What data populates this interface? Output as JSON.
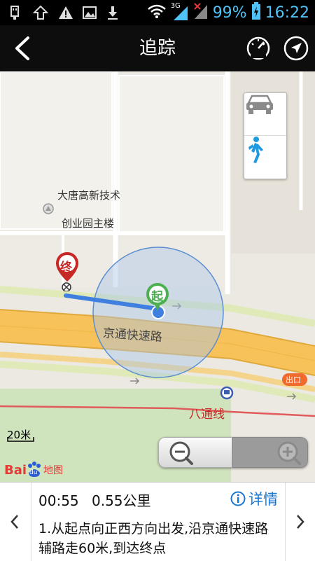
{
  "status_bar": {
    "icons": [
      "usb-icon",
      "upload-icon",
      "warning-icon",
      "image-icon",
      "download-icon",
      "wifi-icon",
      "signal-3g-icon",
      "signal-off-icon",
      "battery-charging-icon"
    ],
    "network_label": "3G",
    "battery_percent": "99%",
    "time": "16:22"
  },
  "header": {
    "title": "追踪",
    "left_icon": "back-chevron-icon",
    "right_icons": [
      "speedometer-icon",
      "navigation-arrow-icon"
    ]
  },
  "map": {
    "labels": {
      "poi_line1": "大唐高新技术",
      "poi_line2": "创业园主楼",
      "road": "京通快速路",
      "subway": "八通线",
      "exit": "出口"
    },
    "markers": {
      "start": "起",
      "end": "终"
    },
    "scale": "20米",
    "logo": {
      "bai": "Bai",
      "du": "du",
      "map_text": "地图"
    },
    "mode_buttons": [
      "car-icon",
      "walk-icon"
    ],
    "zoom": {
      "out_icon": "zoom-out-icon",
      "in_icon": "zoom-in-icon"
    }
  },
  "route_panel": {
    "duration": "00:55",
    "distance": "0.55公里",
    "details_label": "详情",
    "description": "1.从起点向正西方向出发,沿京通快速路辅路走60米,到达终点"
  },
  "colors": {
    "status_accent": "#4fc3f7",
    "road_orange": "#f7c25a",
    "route_blue": "#3f7fe0",
    "start_green": "#4caf50",
    "end_red": "#c62828",
    "details_blue": "#1976d2"
  }
}
